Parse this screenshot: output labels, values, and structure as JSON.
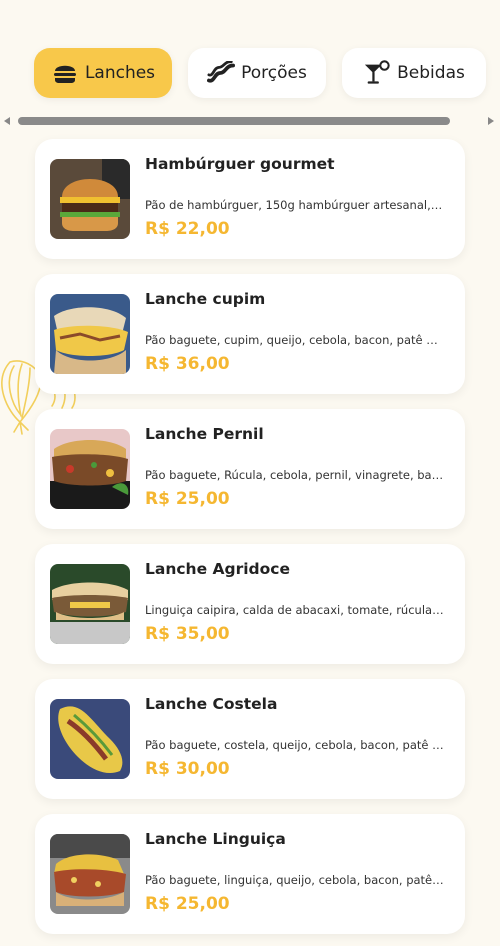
{
  "colors": {
    "accent": "#f8c84a",
    "price": "#f5b731",
    "background": "#fcf9f1"
  },
  "tabs": [
    {
      "label": "Lanches",
      "icon": "burger-icon",
      "active": true
    },
    {
      "label": "Porções",
      "icon": "bacon-icon",
      "active": false
    },
    {
      "label": "Bebidas",
      "icon": "cocktail-icon",
      "active": false
    }
  ],
  "items": [
    {
      "name": "Hambúrguer gourmet",
      "description": "Pão de hambúrguer, 150g hambúrguer artesanal, queijo, bacon",
      "price": "R$ 22,00",
      "image": "burger-photo"
    },
    {
      "name": "Lanche cupim",
      "description": "Pão baguete, cupim, queijo, cebola, bacon, patê de alho",
      "price": "R$ 36,00",
      "image": "baguette-photo"
    },
    {
      "name": "Lanche Pernil",
      "description": "Pão baguete, Rúcula, cebola, pernil, vinagrete, barbecue",
      "price": "R$ 25,00",
      "image": "pernil-photo"
    },
    {
      "name": "Lanche Agridoce",
      "description": "Linguiça caipira, calda de abacaxi, tomate, rúcula, queijo",
      "price": "R$ 35,00",
      "image": "agridoce-photo"
    },
    {
      "name": "Lanche Costela",
      "description": "Pão baguete, costela, queijo, cebola, bacon, patê de alho",
      "price": "R$ 30,00",
      "image": "costela-photo"
    },
    {
      "name": "Lanche Linguiça",
      "description": "Pão baguete, linguiça, queijo, cebola, bacon, patê de alho",
      "price": "R$ 25,00",
      "image": "linguica-photo"
    }
  ]
}
